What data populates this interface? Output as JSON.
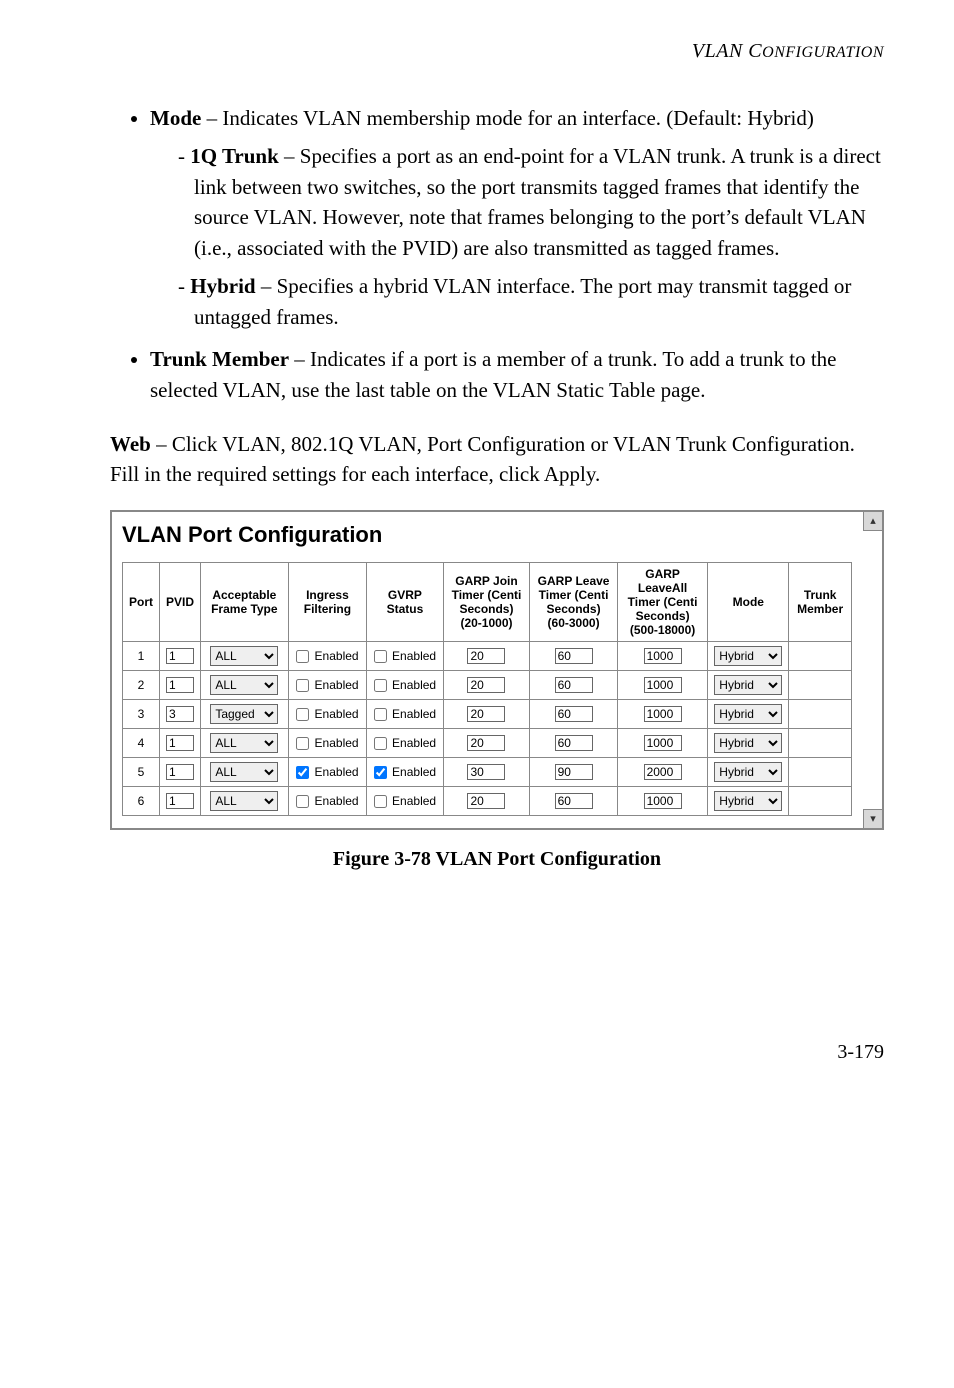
{
  "running_header": {
    "prefix": "VLAN C",
    "smallcaps": "ONFIGURATION"
  },
  "bullets": {
    "mode": {
      "label": "Mode",
      "text": " – Indicates VLAN membership mode for an interface. (Default: Hybrid)",
      "sub": {
        "oneq": {
          "label": "1Q Trunk",
          "text": " – Specifies a port as an end-point for a VLAN trunk. A trunk is a direct link between two switches, so the port transmits tagged frames that identify the source VLAN. However, note that frames belonging to the port’s default VLAN (i.e., associated with the PVID) are also transmitted as tagged frames."
        },
        "hybrid": {
          "label": "Hybrid",
          "text": " – Specifies a hybrid VLAN interface. The port may transmit tagged or untagged frames."
        }
      }
    },
    "trunk_member": {
      "label": "Trunk Member",
      "text": " – Indicates if a port is a member of a trunk. To add a trunk to the selected VLAN, use the last table on the VLAN Static Table page."
    }
  },
  "web_para": {
    "label": "Web",
    "text": " – Click VLAN, 802.1Q VLAN, Port Configuration or VLAN Trunk Configuration. Fill in the required settings for each interface, click Apply."
  },
  "figure": {
    "title": "VLAN Port Configuration",
    "headers": {
      "port": "Port",
      "pvid": "PVID",
      "aft": "Acceptable Frame Type",
      "ingress": "Ingress Filtering",
      "gvrp": "GVRP Status",
      "garp_join": "GARP Join Timer (Centi Seconds) (20-1000)",
      "garp_leave": "GARP Leave Timer (Centi Seconds) (60-3000)",
      "garp_leaveall": "GARP LeaveAll Timer (Centi Seconds) (500-18000)",
      "mode": "Mode",
      "trunk": "Trunk Member"
    },
    "enabled_label": "Enabled",
    "rows": [
      {
        "port": "1",
        "pvid": "1",
        "aft": "ALL",
        "ingress": false,
        "gvrp": false,
        "join": "20",
        "leave": "60",
        "leaveall": "1000",
        "mode": "Hybrid",
        "trunk": ""
      },
      {
        "port": "2",
        "pvid": "1",
        "aft": "ALL",
        "ingress": false,
        "gvrp": false,
        "join": "20",
        "leave": "60",
        "leaveall": "1000",
        "mode": "Hybrid",
        "trunk": ""
      },
      {
        "port": "3",
        "pvid": "3",
        "aft": "Tagged",
        "ingress": false,
        "gvrp": false,
        "join": "20",
        "leave": "60",
        "leaveall": "1000",
        "mode": "Hybrid",
        "trunk": ""
      },
      {
        "port": "4",
        "pvid": "1",
        "aft": "ALL",
        "ingress": false,
        "gvrp": false,
        "join": "20",
        "leave": "60",
        "leaveall": "1000",
        "mode": "Hybrid",
        "trunk": ""
      },
      {
        "port": "5",
        "pvid": "1",
        "aft": "ALL",
        "ingress": true,
        "gvrp": true,
        "join": "30",
        "leave": "90",
        "leaveall": "2000",
        "mode": "Hybrid",
        "trunk": ""
      },
      {
        "port": "6",
        "pvid": "1",
        "aft": "ALL",
        "ingress": false,
        "gvrp": false,
        "join": "20",
        "leave": "60",
        "leaveall": "1000",
        "mode": "Hybrid",
        "trunk": ""
      }
    ]
  },
  "caption": "Figure 3-78  VLAN Port Configuration",
  "page_number": "3-179"
}
